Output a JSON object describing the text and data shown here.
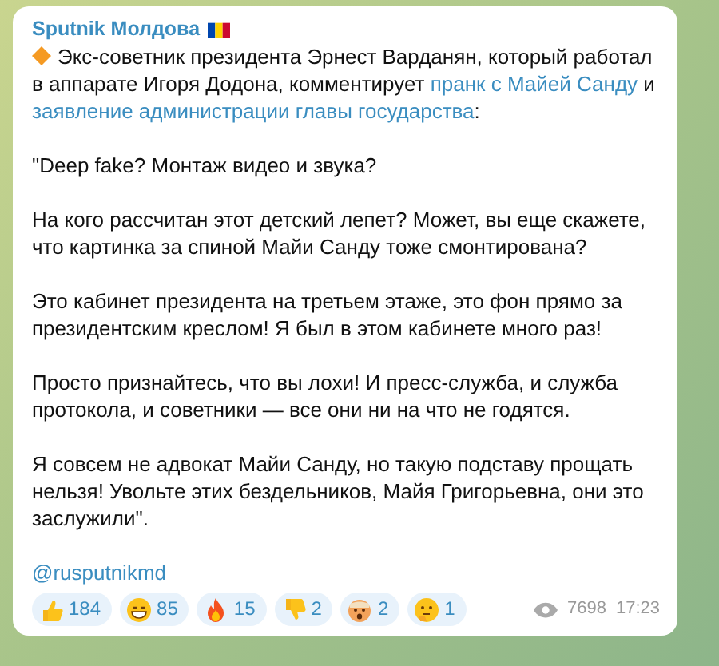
{
  "message": {
    "channel": "Sputnik Молдова",
    "lead": [
      {
        "kind": "text",
        "text": "Экс-советник президента Эрнест Варданян, который работал в аппарате Игоря Додона, комментирует "
      },
      {
        "kind": "link",
        "text": "пранк с Майей Санду"
      },
      {
        "kind": "text",
        "text": " и "
      },
      {
        "kind": "link",
        "text": "заявление администрации главы государства"
      },
      {
        "kind": "text",
        "text": ":"
      }
    ],
    "paragraphs": [
      "\"Deep fake? Монтаж видео и звука?",
      "На кого рассчитан этот детский лепет? Может, вы еще скажете, что картинка за спиной Майи Санду тоже смонтирована?",
      "Это кабинет президента на третьем этаже, это фон прямо за президентским креслом! Я был в этом кабинете много раз!",
      "Просто признайтесь, что вы лохи! И пресс-служба, и служба протокола, и советники — все они ни на что не годятся.",
      "Я совсем не адвокат Майи Санду, но такую подставу прощать нельзя! Увольте этих бездельников, Майя Григорьевна, они это заслужили\"."
    ],
    "signature": "@rusputnikmd",
    "reactions": [
      {
        "kind": "thumbs-up",
        "count": "184"
      },
      {
        "kind": "grin",
        "count": "85"
      },
      {
        "kind": "fire",
        "count": "15"
      },
      {
        "kind": "thumbs-down",
        "count": "2"
      },
      {
        "kind": "shocked",
        "count": "2"
      },
      {
        "kind": "thinking",
        "count": "1"
      }
    ],
    "views": "7698",
    "time": "17:23"
  }
}
